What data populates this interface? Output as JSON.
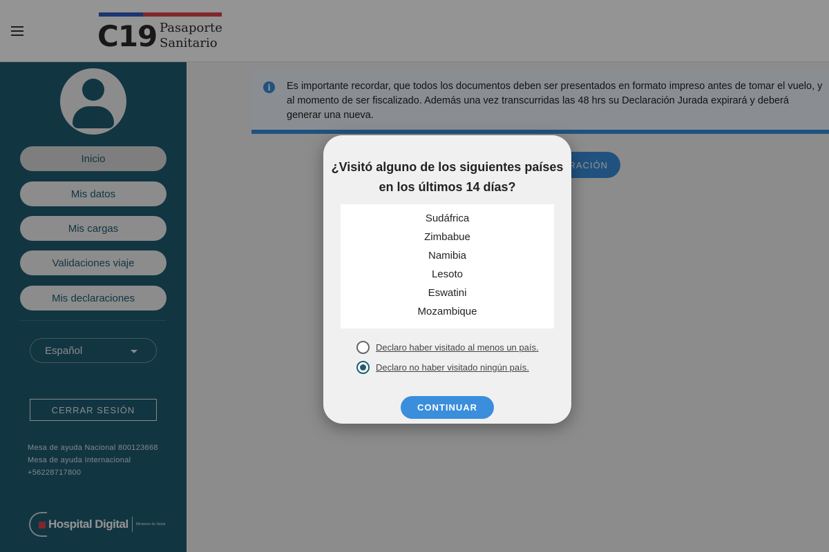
{
  "header": {
    "logo_short": "C19",
    "logo_line1": "Pasaporte",
    "logo_line2": "Sanitario",
    "flag_colors": {
      "blue": "#2f5ec4",
      "red": "#e0424f"
    }
  },
  "sidebar": {
    "nav_items": [
      {
        "label": "Inicio",
        "active": true
      },
      {
        "label": "Mis datos"
      },
      {
        "label": "Mis cargas"
      },
      {
        "label": "Validaciones viaje"
      },
      {
        "label": "Mis declaraciones"
      }
    ],
    "language": "Español",
    "logout_label": "CERRAR SESIÓN",
    "help_lines": [
      "Mesa de ayuda Nacional 800123668",
      "Mesa de ayuda Internacional",
      "+56228717800"
    ],
    "footer_logo": "Hospital Digital",
    "footer_ministry": "Ministerio de Salud"
  },
  "main": {
    "info_text": "Es importante recordar, que todos los documentos deben ser presentados en formato impreso antes de tomar el vuelo, y al momento de ser fiscalizado. Además una vez transcurridas las 48 hrs su Declaración Jurada expirará y deberá generar una nueva.",
    "declaration_button_partial": "RACIÓN"
  },
  "modal": {
    "title_line1": "¿Visitó alguno de los siguientes países",
    "title_line2": "en los últimos 14 días?",
    "countries": [
      "Sudáfrica",
      "Zimbabue",
      "Namibia",
      "Lesoto",
      "Eswatini",
      "Mozambique"
    ],
    "options": [
      {
        "label": "Declaro haber visitado al menos un país.",
        "checked": false
      },
      {
        "label": "Declaro no haber visitado ningún país.",
        "checked": true
      }
    ],
    "continue_label": "CONTINUAR"
  },
  "colors": {
    "sidebar": "#1f5c72",
    "accent": "#3a8edb",
    "info_background": "#eef4fb"
  }
}
